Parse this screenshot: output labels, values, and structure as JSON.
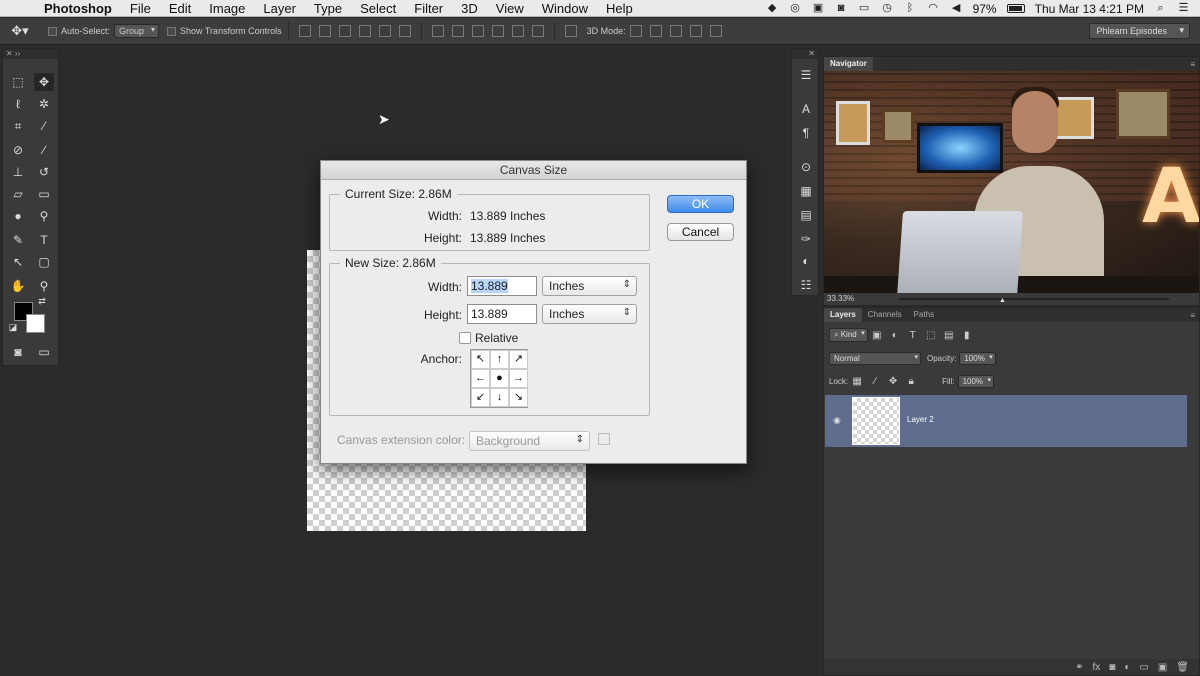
{
  "menubar": {
    "apple": "",
    "items": [
      "Photoshop",
      "File",
      "Edit",
      "Image",
      "Layer",
      "Type",
      "Select",
      "Filter",
      "3D",
      "View",
      "Window",
      "Help"
    ],
    "battery": "97%",
    "clock": "Thu Mar 13  4:21 PM"
  },
  "options": {
    "auto_select": "Auto-Select:",
    "group": "Group",
    "show_transform": "Show Transform Controls",
    "mode_3d": "3D Mode:",
    "workspace": "Phlearn Episodes"
  },
  "dialog": {
    "title": "Canvas Size",
    "current_legend": "Current Size: 2.86M",
    "width_label": "Width:",
    "width_value": "13.889 Inches",
    "height_label": "Height:",
    "height_value": "13.889 Inches",
    "new_legend": "New Size: 2.86M",
    "new_width_label": "Width:",
    "new_width": "13.889",
    "new_height_label": "Height:",
    "new_height": "13.889",
    "unit": "Inches",
    "relative": "Relative",
    "anchor_label": "Anchor:",
    "ext_label": "Canvas extension color:",
    "ext_value": "Background",
    "ok": "OK",
    "cancel": "Cancel"
  },
  "navigator": {
    "tab": "Navigator",
    "zoom": "33.33%"
  },
  "layers": {
    "tabs": [
      "Layers",
      "Channels",
      "Paths"
    ],
    "kind": "Kind",
    "blend": "Normal",
    "opacity_label": "Opacity:",
    "opacity": "100%",
    "lock_label": "Lock:",
    "fill_label": "Fill:",
    "fill": "100%",
    "layer_name": "Layer 2"
  }
}
